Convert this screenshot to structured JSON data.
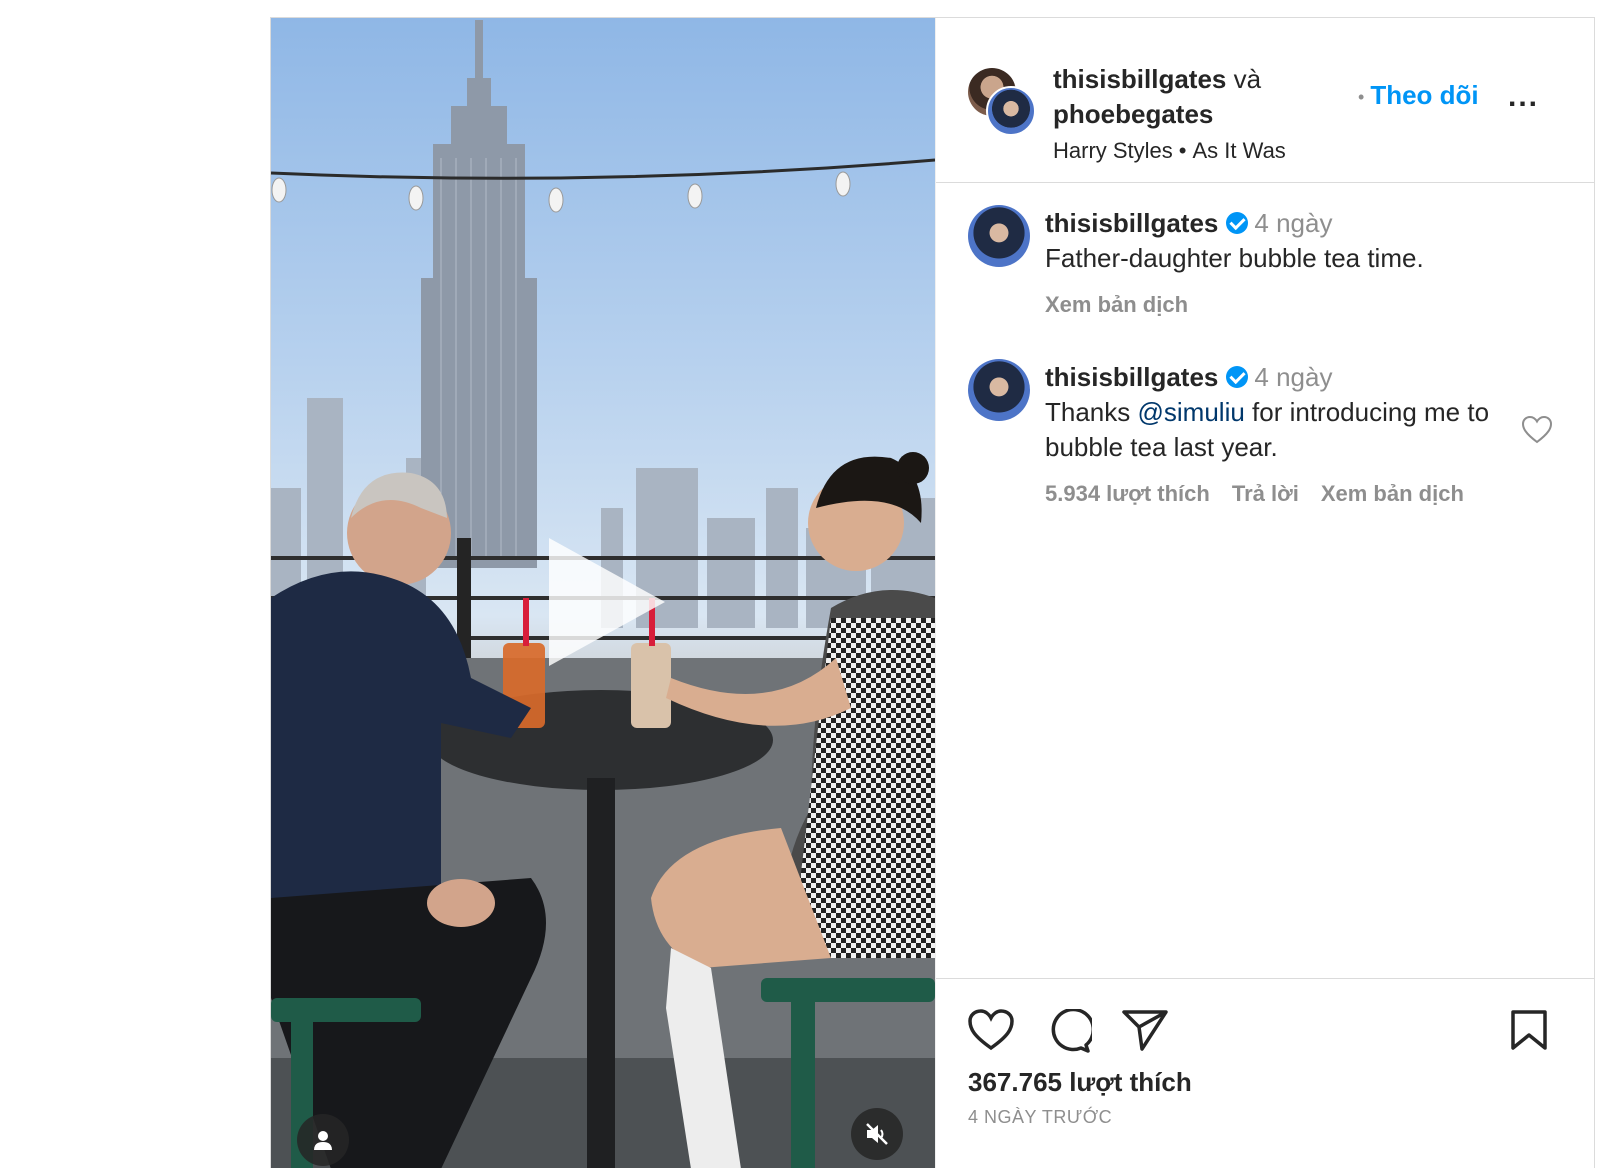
{
  "header": {
    "user1": "thisisbillgates",
    "conjunction": "và",
    "user2": "phoebegates",
    "music_artist": "Harry Styles",
    "music_sep": "•",
    "music_title": "As It Was",
    "follow_sep": "•",
    "follow_label": "Theo dõi",
    "more_label": "..."
  },
  "comments": [
    {
      "username": "thisisbillgates",
      "time": "4 ngày",
      "text": "Father-daughter bubble tea time.",
      "translate": "Xem bản dịch"
    },
    {
      "username": "thisisbillgates",
      "time": "4 ngày",
      "text_before": "Thanks ",
      "mention": "@simuliu",
      "text_after": " for introducing me to bubble tea last year.",
      "likes": "5.934 lượt thích",
      "reply": "Trả lời",
      "translate": "Xem bản dịch"
    }
  ],
  "footer": {
    "likes": "367.765 lượt thích",
    "posted": "4 NGÀY TRƯỚC"
  },
  "icons": {
    "like": "heart-icon",
    "comment": "comment-icon",
    "share": "paper-plane-icon",
    "save": "bookmark-icon",
    "comment_like": "heart-icon",
    "user_tags": "user-icon",
    "mute": "speaker-muted-icon",
    "play": "play-icon"
  },
  "colors": {
    "link": "#0095f6",
    "mention": "#00376b",
    "verified": "#0095f6",
    "muted_text": "#8e8e8e"
  }
}
